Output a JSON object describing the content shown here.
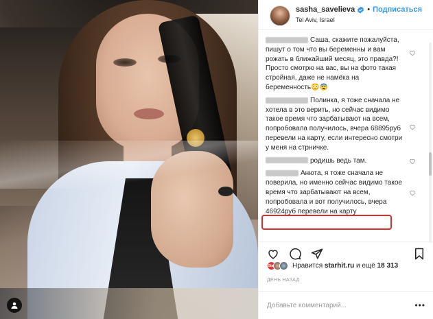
{
  "post": {
    "username": "sasha_savelieva",
    "dot": "•",
    "follow_label": "Подписаться",
    "location": "Tel Aviv, Israel"
  },
  "comments": [
    {
      "text": "Саша, скажите пожалуйста, пишут о том что вы беременны и вам рожать в ближайший месяц, это правда?! Просто смотрю на вас, вы на фото такая стройная, даже не намёка на беременность😳😨",
      "blur_width": 62
    },
    {
      "text": "Полинка, я тоже сначала не хотела в это верить, но сейчас видимо такое время что зарбатывают на всем, попробовала получилось, вчера 68895руб перевели на карту, если интересно смотри у меня на стрничке.",
      "blur_width": 62
    },
    {
      "text": "родишь ведь там.",
      "blur_width": 62
    },
    {
      "text": "Анюта, я тоже сначала не поверила, но именно сейчас видимо такое время что зарбатывают на всем, попробовала и вот получилось, вчера 46924руб перевели на карту",
      "blur_width": 48
    }
  ],
  "likes": {
    "avatar_a_label": "Star",
    "prefix": "Нравится",
    "user": "starhit.ru",
    "suffix": "и ещё",
    "count": "18 313"
  },
  "time_ago": "ДЕНЬ НАЗАД",
  "add_comment": {
    "placeholder": "Добавьте комментарий...",
    "more": "•••"
  },
  "colors": {
    "accent": "#3897f0",
    "highlight": "#d62d2d",
    "text": "#262626",
    "muted": "#999999"
  },
  "icons": [
    "verified-badge-icon",
    "heart-icon",
    "comment-icon",
    "share-icon",
    "bookmark-icon",
    "tag-person-icon"
  ]
}
